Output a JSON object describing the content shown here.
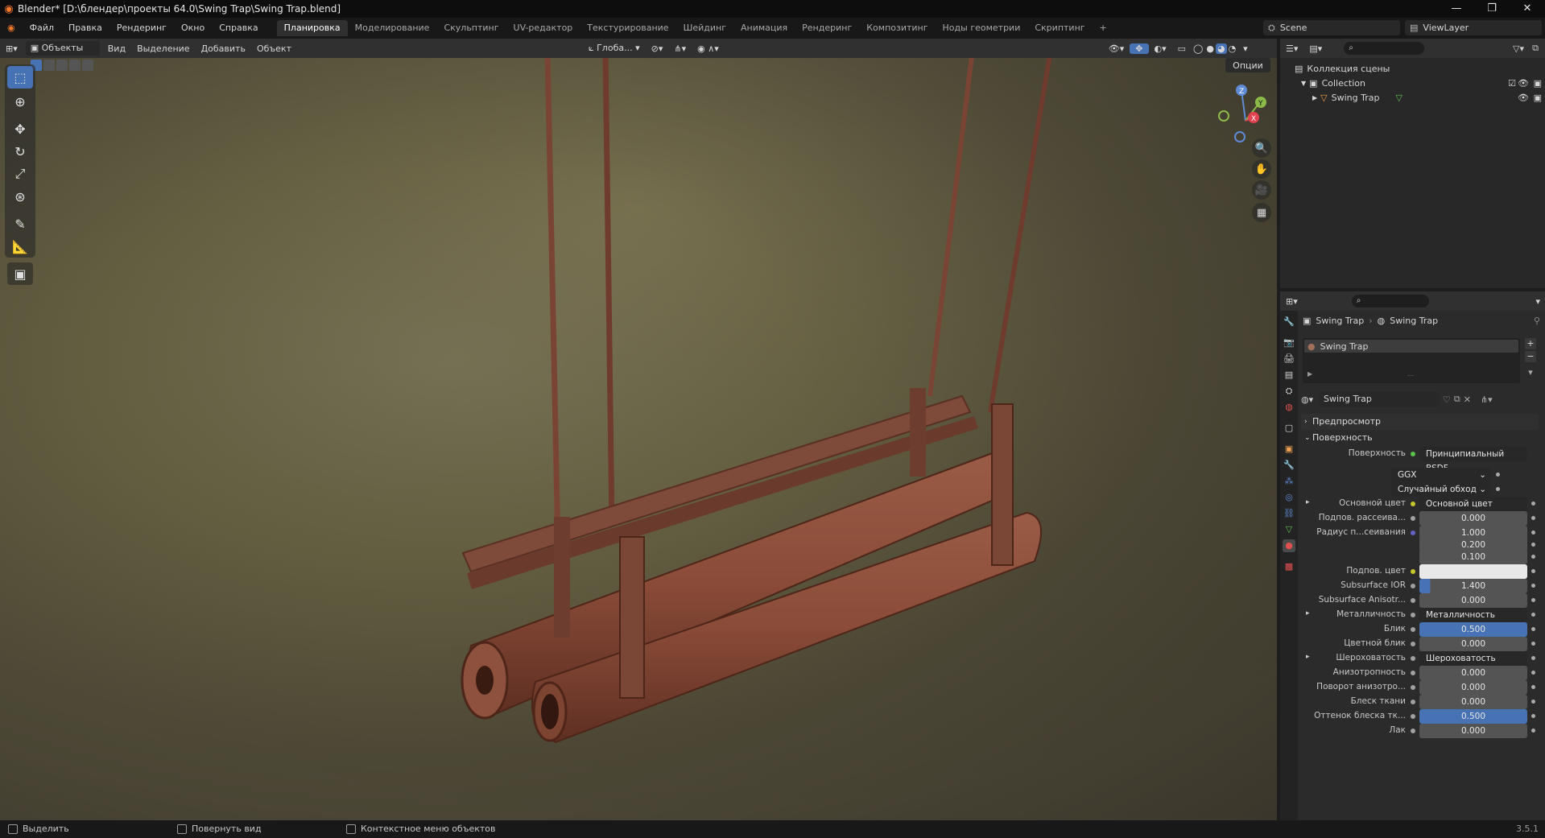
{
  "window": {
    "title": "Blender* [D:\\блендер\\проекты 64.0\\Swing Trap\\Swing Trap.blend]",
    "controls": [
      "—",
      "❐",
      "✕"
    ]
  },
  "menubar": {
    "menus": [
      "Файл",
      "Правка",
      "Рендеринг",
      "Окно",
      "Справка"
    ],
    "workspaces": [
      "Планировка",
      "Моделирование",
      "Скульптинг",
      "UV-редактор",
      "Текстурирование",
      "Шейдинг",
      "Анимация",
      "Рендеринг",
      "Композитинг",
      "Ноды геометрии",
      "Скриптинг"
    ],
    "active_workspace": "Планировка",
    "add_tab": "+",
    "scene": "Scene",
    "view_layer": "ViewLayer"
  },
  "viewport_header": {
    "mode": "Объекты",
    "menus": [
      "Вид",
      "Выделение",
      "Добавить",
      "Объект"
    ],
    "transform_orientation": "Глоба...",
    "options": "Опции"
  },
  "gizmo": {
    "z": "Z",
    "y": "Y",
    "x": "X"
  },
  "outliner": {
    "scene_collection": "Коллекция сцены",
    "collection": "Collection",
    "object": "Swing Trap"
  },
  "properties": {
    "breadcrumb_object": "Swing Trap",
    "breadcrumb_material": "Swing Trap",
    "material_slot": "Swing Trap",
    "material_name": "Swing Trap",
    "sections": {
      "preview": "Предпросмотр",
      "surface": "Поверхность"
    },
    "surface_label": "Поверхность",
    "surface_value": "Принципиальный BSDF",
    "distribution": "GGX",
    "subsurface_method": "Случайный обход",
    "rows": [
      {
        "label": "Основной цвет",
        "value": "Основной цвет",
        "kind": "link",
        "dot": "#c7c729"
      },
      {
        "label": "Подпов. рассеива...",
        "value": "0.000",
        "kind": "num",
        "dot": "#a1a1a1"
      },
      {
        "label": "Радиус п...сеивания",
        "value": "1.000",
        "kind": "num",
        "dot": "#6363c7"
      },
      {
        "label": "",
        "value": "0.200",
        "kind": "num",
        "dot": ""
      },
      {
        "label": "",
        "value": "0.100",
        "kind": "num",
        "dot": ""
      },
      {
        "label": "Подпов. цвет",
        "value": "",
        "kind": "color",
        "dot": "#c7c729"
      },
      {
        "label": "Subsurface IOR",
        "value": "1.400",
        "kind": "num",
        "dot": "#a1a1a1"
      },
      {
        "label": "Subsurface Anisotr...",
        "value": "0.000",
        "kind": "num",
        "dot": "#a1a1a1"
      },
      {
        "label": "Металличность",
        "value": "Металличность",
        "kind": "link",
        "dot": "#a1a1a1"
      },
      {
        "label": "Блик",
        "value": "0.500",
        "kind": "blue",
        "dot": "#a1a1a1"
      },
      {
        "label": "Цветной блик",
        "value": "0.000",
        "kind": "num",
        "dot": "#a1a1a1"
      },
      {
        "label": "Шероховатость",
        "value": "Шероховатость",
        "kind": "link",
        "dot": "#a1a1a1"
      },
      {
        "label": "Анизотропность",
        "value": "0.000",
        "kind": "num",
        "dot": "#a1a1a1"
      },
      {
        "label": "Поворот анизотро...",
        "value": "0.000",
        "kind": "num",
        "dot": "#a1a1a1"
      },
      {
        "label": "Блеск ткани",
        "value": "0.000",
        "kind": "num",
        "dot": "#a1a1a1"
      },
      {
        "label": "Оттенок блеска тк...",
        "value": "0.500",
        "kind": "blue",
        "dot": "#a1a1a1"
      },
      {
        "label": "Лак",
        "value": "0.000",
        "kind": "num",
        "dot": "#a1a1a1"
      }
    ]
  },
  "statusbar": {
    "select": "Выделить",
    "rotate_view": "Повернуть вид",
    "context_menu": "Контекстное меню объектов",
    "version": "3.5.1"
  },
  "colors": {
    "accent": "#4772b3",
    "rust": "#8a4a36",
    "background": "#1d1d1d"
  }
}
